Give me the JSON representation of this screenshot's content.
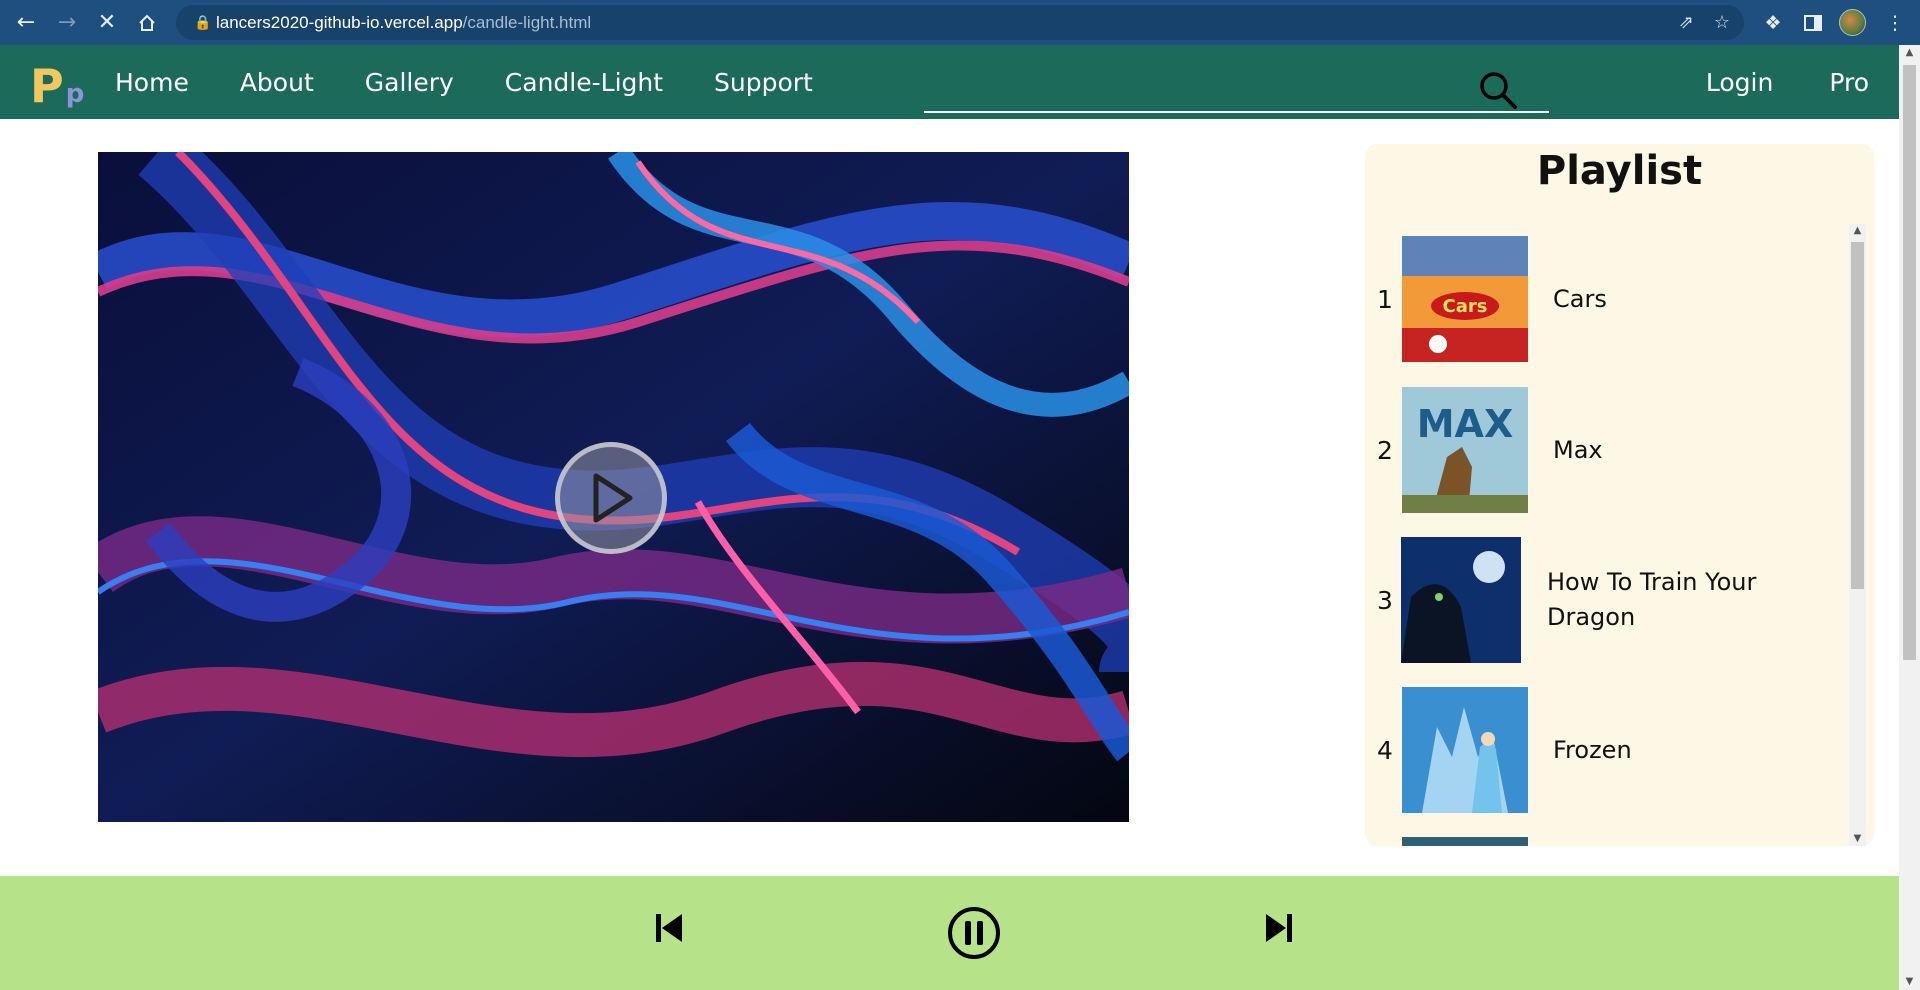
{
  "browser": {
    "url_host": "lancers2020-github-io.vercel.app",
    "url_path": "/candle-light.html",
    "icons": [
      "back-icon",
      "forward-icon",
      "stop-icon",
      "home-icon",
      "lock-icon",
      "share-icon",
      "star-icon",
      "extensions-icon",
      "sidepanel-icon",
      "avatar",
      "menu-icon"
    ]
  },
  "site": {
    "logo_big": "P",
    "logo_small": "p",
    "nav": [
      "Home",
      "About",
      "Gallery",
      "Candle-Light",
      "Support"
    ],
    "search_placeholder": "",
    "nav_right": [
      "Login",
      "Pro"
    ]
  },
  "playlist": {
    "title": "Playlist",
    "items": [
      {
        "num": "1",
        "title": "Cars"
      },
      {
        "num": "2",
        "title": "Max"
      },
      {
        "num": "3",
        "title": "How To Train Your Dragon"
      },
      {
        "num": "4",
        "title": "Frozen"
      }
    ]
  },
  "player": {
    "buttons": [
      "previous-icon",
      "pause-icon",
      "next-icon"
    ]
  },
  "colors": {
    "chrome": "#1e4f7e",
    "site_nav": "#1c6b5a",
    "logo_big": "#f1c75f",
    "logo_small": "#8b93d9",
    "playlist_bg": "#fdf7e6",
    "player_bg": "#b6e28a"
  }
}
